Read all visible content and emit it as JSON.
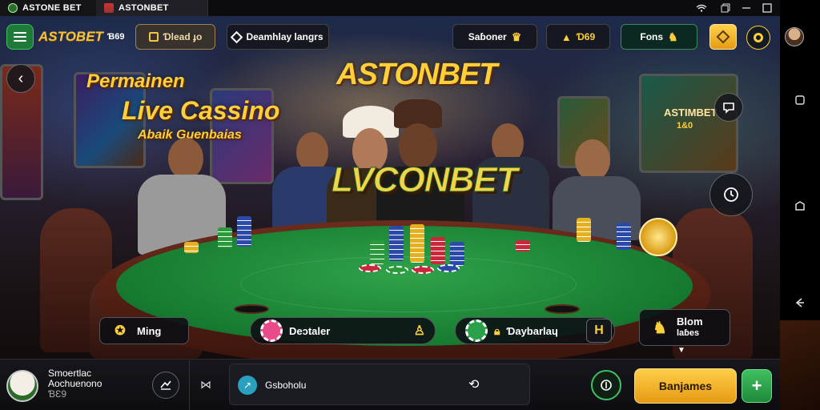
{
  "tabs": [
    {
      "label": "ASTONE BET",
      "icon": "casino-logo-icon"
    },
    {
      "label": "ASTONBET",
      "icon": "game-thumbnail-icon"
    }
  ],
  "window": {
    "wifi": "wifi-icon",
    "restore": "restore-icon",
    "minimize": "minimize-icon",
    "maximize": "maximize-icon",
    "close": "close-icon"
  },
  "header": {
    "menu_icon": "menu-icon",
    "brand": "ASTOBET",
    "brand_suffix": "Ɓ69",
    "promo_label": "Ɗlead ɟo",
    "promo_icon": "gift-icon",
    "games_label": "Deamhlay langrs",
    "games_icon": "diamond-icon",
    "settings_label": "Saɓoner",
    "settings_icon": "crown-icon",
    "balance_label": "Ɗ69",
    "balance_icon": "trophy-icon",
    "fonts_label": "Fons",
    "fonts_icon": "lion-crest-icon",
    "wallet_icon": "wallet-icon",
    "profile_icon": "chip-icon"
  },
  "scene": {
    "title": "ASTONBET",
    "sign_line1": "Permainen",
    "sign_line2": "Live Cassino",
    "sign_line3": "Abaik Guenbaias",
    "table_logo": "LVCONBET",
    "screen_right_text": "ASTIMBET",
    "screen_right_sub": "1&0"
  },
  "seats": [
    {
      "label": "Ming",
      "icon": "crest-icon"
    },
    {
      "label": "Deɔtaler",
      "icon": "poker-chip-pink-icon",
      "extra_icon": "hand-icon"
    },
    {
      "label": "Ɗaybarlaɥ",
      "icon": "poker-chip-green-icon",
      "extra_icon": "lock-icon",
      "action_icon": "h-icon"
    },
    {
      "label": "Blom",
      "sublabel": "laɓes",
      "icon": "lion-icon"
    }
  ],
  "side_buttons": {
    "back": "back-arrow-icon",
    "chat": "chat-icon",
    "timer": "clock-icon",
    "scroll_down": "chevron-down-icon"
  },
  "bottom": {
    "player_name": "Smoertlac",
    "player_sub": "Aochuenono",
    "player_extra": "ƁƐ9",
    "player_icon": "player-avatar-icon",
    "history_icon": "history-icon",
    "swap_icon": "swap-icon",
    "chat_label": "Gsboholu",
    "chat_icon": "trend-icon",
    "chat_action_icon": "refresh-icon",
    "bet_icon": "bet-icon",
    "play_label": "Banjames",
    "add_label": "+"
  },
  "android_nav": {
    "avatar": "user-avatar-icon",
    "home": "home-icon",
    "back": "back-icon",
    "recents": "recents-icon"
  },
  "colors": {
    "accent_green": "#1f8a3a",
    "accent_gold": "#ffcf3a",
    "play_orange": "#f2a91c"
  }
}
